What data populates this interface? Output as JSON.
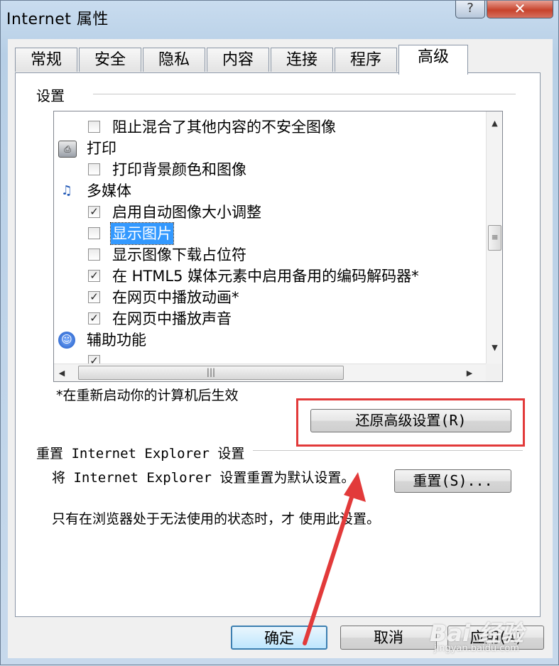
{
  "window": {
    "title": "Internet 属性",
    "help_label": "?",
    "close_label": "✕"
  },
  "tabs": [
    {
      "label": "常规"
    },
    {
      "label": "安全"
    },
    {
      "label": "隐私"
    },
    {
      "label": "内容"
    },
    {
      "label": "连接"
    },
    {
      "label": "程序"
    },
    {
      "label": "高级",
      "active": true
    }
  ],
  "settings": {
    "group_label": "设置",
    "rows": [
      {
        "type": "checkbox",
        "checked": false,
        "label": "阻止混合了其他内容的不安全图像"
      },
      {
        "type": "category",
        "icon": "printer-icon",
        "label": "打印"
      },
      {
        "type": "checkbox",
        "checked": false,
        "label": "打印背景颜色和图像"
      },
      {
        "type": "category",
        "icon": "multimedia-icon",
        "label": "多媒体"
      },
      {
        "type": "checkbox",
        "checked": true,
        "label": "启用自动图像大小调整"
      },
      {
        "type": "checkbox",
        "checked": false,
        "label": "显示图片",
        "selected": true
      },
      {
        "type": "checkbox",
        "checked": false,
        "label": "显示图像下载占位符"
      },
      {
        "type": "checkbox",
        "checked": true,
        "label": "在 HTML5 媒体元素中启用备用的编码解码器*"
      },
      {
        "type": "checkbox",
        "checked": true,
        "label": "在网页中播放动画*"
      },
      {
        "type": "checkbox",
        "checked": true,
        "label": "在网页中播放声音"
      },
      {
        "type": "category",
        "icon": "accessibility-icon",
        "label": "辅助功能"
      }
    ],
    "restart_note": "*在重新启动你的计算机后生效",
    "restore_button": "还原高级设置(R)"
  },
  "reset": {
    "title": "重置 Internet Explorer 设置",
    "description": "将 Internet Explorer 设置重置为默认设置。",
    "button": "重置(S)...",
    "warning": "只有在浏览器处于无法使用的状态时，才  使用此设置。"
  },
  "footer": {
    "ok": "确定",
    "cancel": "取消",
    "apply": "应用(A)"
  },
  "watermark": {
    "text": "Bai 经验",
    "sub": "jingyan.baidu.com"
  },
  "colors": {
    "highlight_border": "#e23a3a",
    "selection": "#3399ff"
  }
}
